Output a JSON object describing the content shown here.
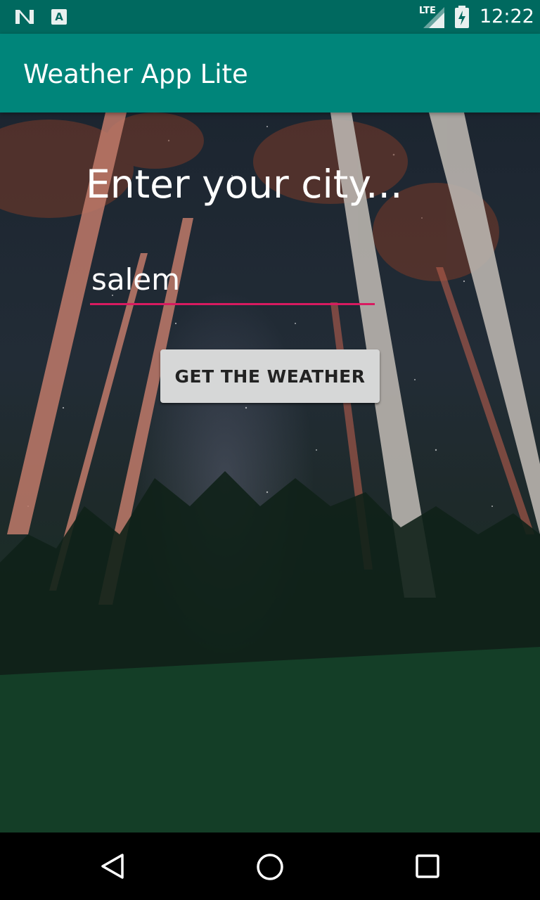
{
  "status_bar": {
    "time": "12:22",
    "network": "LTE",
    "left_icons": [
      "n-logo-icon",
      "a-notification-icon"
    ]
  },
  "app_bar": {
    "title": "Weather App Lite",
    "color": "#00857a"
  },
  "main": {
    "prompt": "Enter your city...",
    "city_input": {
      "value": "salem",
      "accent": "#d81b60"
    },
    "get_weather_button": "GET THE WEATHER"
  },
  "nav_bar": {
    "buttons": [
      "back-icon",
      "home-icon",
      "recents-icon"
    ]
  }
}
